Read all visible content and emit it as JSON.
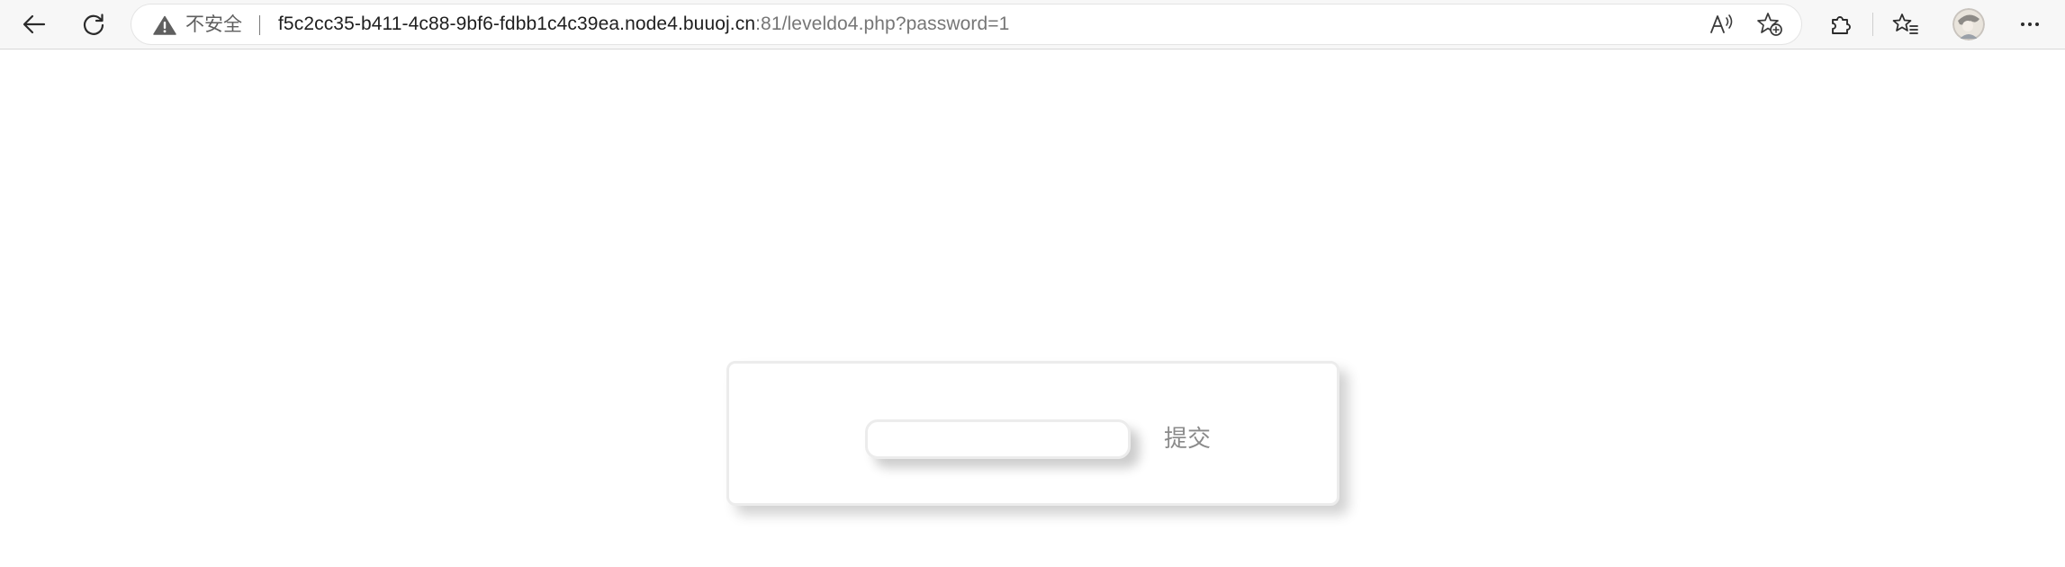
{
  "browser": {
    "security_label": "不安全",
    "url_host": "f5c2cc35-b411-4c88-9bf6-fdbb1c4c39ea.node4.buuoj.cn",
    "url_rest": ":81/leveldo4.php?password=1",
    "icons": {
      "back": "back-arrow-icon",
      "reload": "reload-icon",
      "warning": "warning-icon",
      "read_aloud": "read-aloud-icon",
      "add_favorite": "add-favorite-icon",
      "extensions": "extensions-icon",
      "favorites": "favorites-icon",
      "profile": "profile-avatar",
      "more": "more-options-icon"
    }
  },
  "form": {
    "password_value": "",
    "submit_label": "提交"
  }
}
